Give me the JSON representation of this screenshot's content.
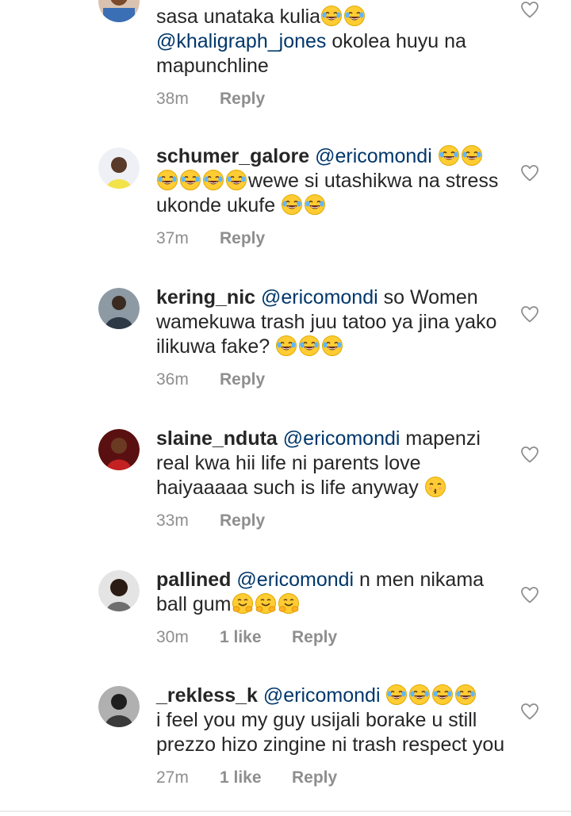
{
  "comments": [
    {
      "id": "c0",
      "username": "",
      "mention": "",
      "segments": [
        {
          "t": "text",
          "v": "sasa unataka kulia"
        },
        {
          "t": "emoji",
          "v": "😂"
        },
        {
          "t": "emoji",
          "v": "😂"
        },
        {
          "t": "br"
        },
        {
          "t": "mention",
          "v": "@khaligraph_jones"
        },
        {
          "t": "text",
          "v": "  okolea huyu na mapunchline"
        }
      ],
      "time": "38m",
      "likes": "",
      "reply": "Reply"
    },
    {
      "id": "c1",
      "username": "schumer_galore",
      "segments": [
        {
          "t": "mention",
          "v": "@ericomondi"
        },
        {
          "t": "text",
          "v": " "
        },
        {
          "t": "emoji",
          "v": "😂"
        },
        {
          "t": "emoji",
          "v": "😂"
        },
        {
          "t": "emoji",
          "v": "😂"
        },
        {
          "t": "emoji",
          "v": "😂"
        },
        {
          "t": "emoji",
          "v": "😂"
        },
        {
          "t": "emoji",
          "v": "😂"
        },
        {
          "t": "text",
          "v": "wewe si utashikwa na stress ukonde ukufe "
        },
        {
          "t": "emoji",
          "v": "😂"
        },
        {
          "t": "emoji",
          "v": "😂"
        }
      ],
      "time": "37m",
      "likes": "",
      "reply": "Reply"
    },
    {
      "id": "c2",
      "username": "kering_nic",
      "segments": [
        {
          "t": "mention",
          "v": "@ericomondi"
        },
        {
          "t": "text",
          "v": " so Women wamekuwa trash juu tatoo ya jina yako ilikuwa fake? "
        },
        {
          "t": "emoji",
          "v": "😂"
        },
        {
          "t": "emoji",
          "v": "😂"
        },
        {
          "t": "emoji",
          "v": "😂"
        }
      ],
      "time": "36m",
      "likes": "",
      "reply": "Reply"
    },
    {
      "id": "c3",
      "username": "slaine_nduta",
      "segments": [
        {
          "t": "mention",
          "v": "@ericomondi"
        },
        {
          "t": "text",
          "v": " mapenzi real kwa hii life ni parents love haiyaaaaa such is life anyway "
        },
        {
          "t": "emoji",
          "v": "😙"
        }
      ],
      "time": "33m",
      "likes": "",
      "reply": "Reply"
    },
    {
      "id": "c4",
      "username": "pallined",
      "segments": [
        {
          "t": "mention",
          "v": "@ericomondi"
        },
        {
          "t": "text",
          "v": " n men nikama ball gum"
        },
        {
          "t": "emoji",
          "v": "🤗"
        },
        {
          "t": "emoji",
          "v": "🤗"
        },
        {
          "t": "emoji",
          "v": "🤗"
        }
      ],
      "time": "30m",
      "likes": "1 like",
      "reply": "Reply"
    },
    {
      "id": "c5",
      "username": "_rekless_k",
      "segments": [
        {
          "t": "mention",
          "v": "@ericomondi"
        },
        {
          "t": "text",
          "v": " "
        },
        {
          "t": "emoji",
          "v": "😂"
        },
        {
          "t": "emoji",
          "v": "😂"
        },
        {
          "t": "emoji",
          "v": "😂"
        },
        {
          "t": "emoji",
          "v": "😂"
        },
        {
          "t": "br"
        },
        {
          "t": "text",
          "v": "i feel you my guy usijali borake u still prezzo hizo zingine ni trash respect you"
        }
      ],
      "time": "27m",
      "likes": "1 like",
      "reply": "Reply"
    }
  ],
  "icons": {
    "heart": "heart-outline-icon",
    "laugh": "face-with-tears-of-joy-icon",
    "kiss": "kissing-face-icon",
    "hug": "hugging-face-icon"
  },
  "colors": {
    "text": "#262626",
    "mention": "#00376b",
    "meta": "#8e8e8e",
    "heart": "#8e8e8e"
  }
}
